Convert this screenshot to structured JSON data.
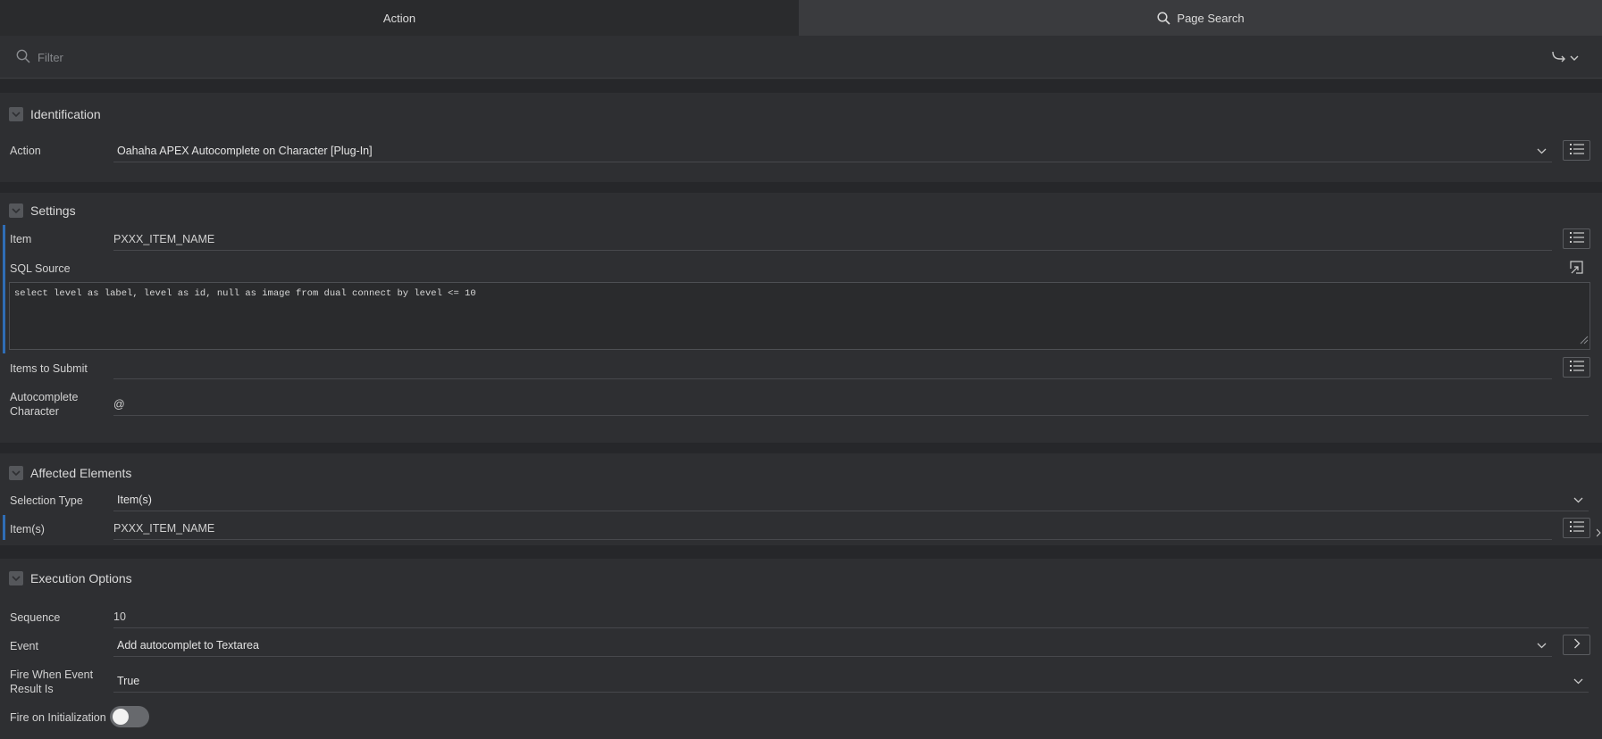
{
  "tabs": {
    "action": "Action",
    "page_search": "Page Search"
  },
  "filter": {
    "placeholder": "Filter"
  },
  "sections": {
    "identification": {
      "title": "Identification",
      "action_label": "Action",
      "action_value": "Oahaha APEX Autocomplete on Character [Plug-In]"
    },
    "settings": {
      "title": "Settings",
      "item_label": "Item",
      "item_value": "PXXX_ITEM_NAME",
      "sql_label": "SQL Source",
      "sql_value": "select level as label, level as id, null as image from dual connect by level <= 10",
      "items_submit_label": "Items to Submit",
      "items_submit_value": "",
      "autocomplete_label_1": "Autocomplete",
      "autocomplete_label_2": "Character",
      "autocomplete_value": "@"
    },
    "affected": {
      "title": "Affected Elements",
      "selection_type_label": "Selection Type",
      "selection_type_value": "Item(s)",
      "items_label": "Item(s)",
      "items_value": "PXXX_ITEM_NAME"
    },
    "execution": {
      "title": "Execution Options",
      "sequence_label": "Sequence",
      "sequence_value": "10",
      "event_label": "Event",
      "event_value": "Add autocomplet to Textarea",
      "fire_when_label_1": "Fire When Event",
      "fire_when_label_2": "Result Is",
      "fire_when_value": "True",
      "fire_init_label": "Fire on Initialization",
      "fire_init_on": false
    }
  },
  "colors": {
    "accent_bar": "#2f6db5",
    "background": "#2a2b2d",
    "panel": "#2e2f32"
  }
}
